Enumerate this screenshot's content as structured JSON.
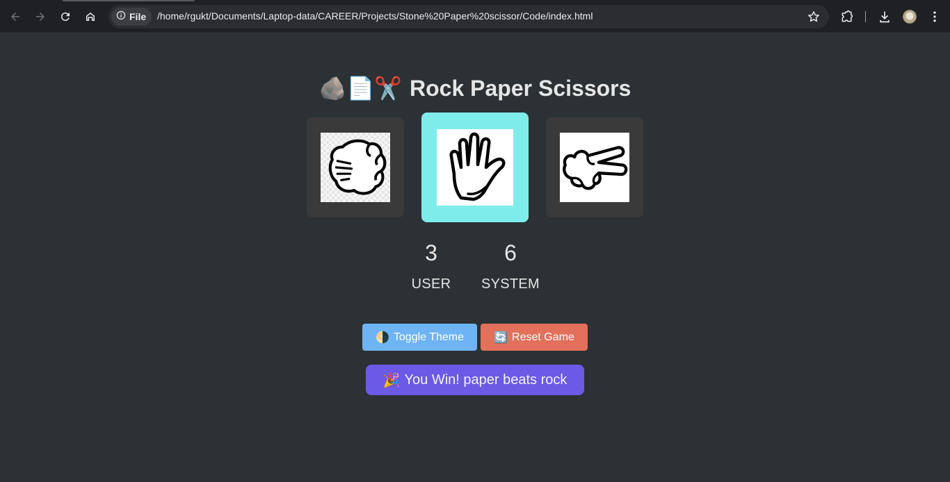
{
  "browser": {
    "scheme_label": "File",
    "url": "/home/rgukt/Documents/Laptop-data/CAREER/Projects/Stone%20Paper%20scissor/Code/index.html",
    "icons": [
      "back-icon",
      "forward-icon",
      "reload-icon",
      "home-icon",
      "info-icon",
      "star-icon",
      "extensions-icon",
      "download-icon",
      "avatar",
      "menu-icon"
    ]
  },
  "game": {
    "title_emoji": "🪨📄✂️",
    "title": "Rock Paper Scissors",
    "choices": [
      "rock",
      "paper",
      "scissors"
    ],
    "selected_choice": "paper",
    "selected_color": "#7fecec",
    "scores": {
      "user": "3",
      "user_label": "USER",
      "system": "6",
      "system_label": "SYSTEM"
    },
    "buttons": {
      "theme_emoji": "🌗",
      "theme_label": "Toggle Theme",
      "theme_color": "#6eb4f5",
      "reset_emoji": "🔄",
      "reset_label": "Reset Game",
      "reset_color": "#e2705a"
    },
    "result": {
      "emoji": "🎉",
      "text": "You Win! paper beats rock",
      "color": "#6a5ae5"
    }
  }
}
